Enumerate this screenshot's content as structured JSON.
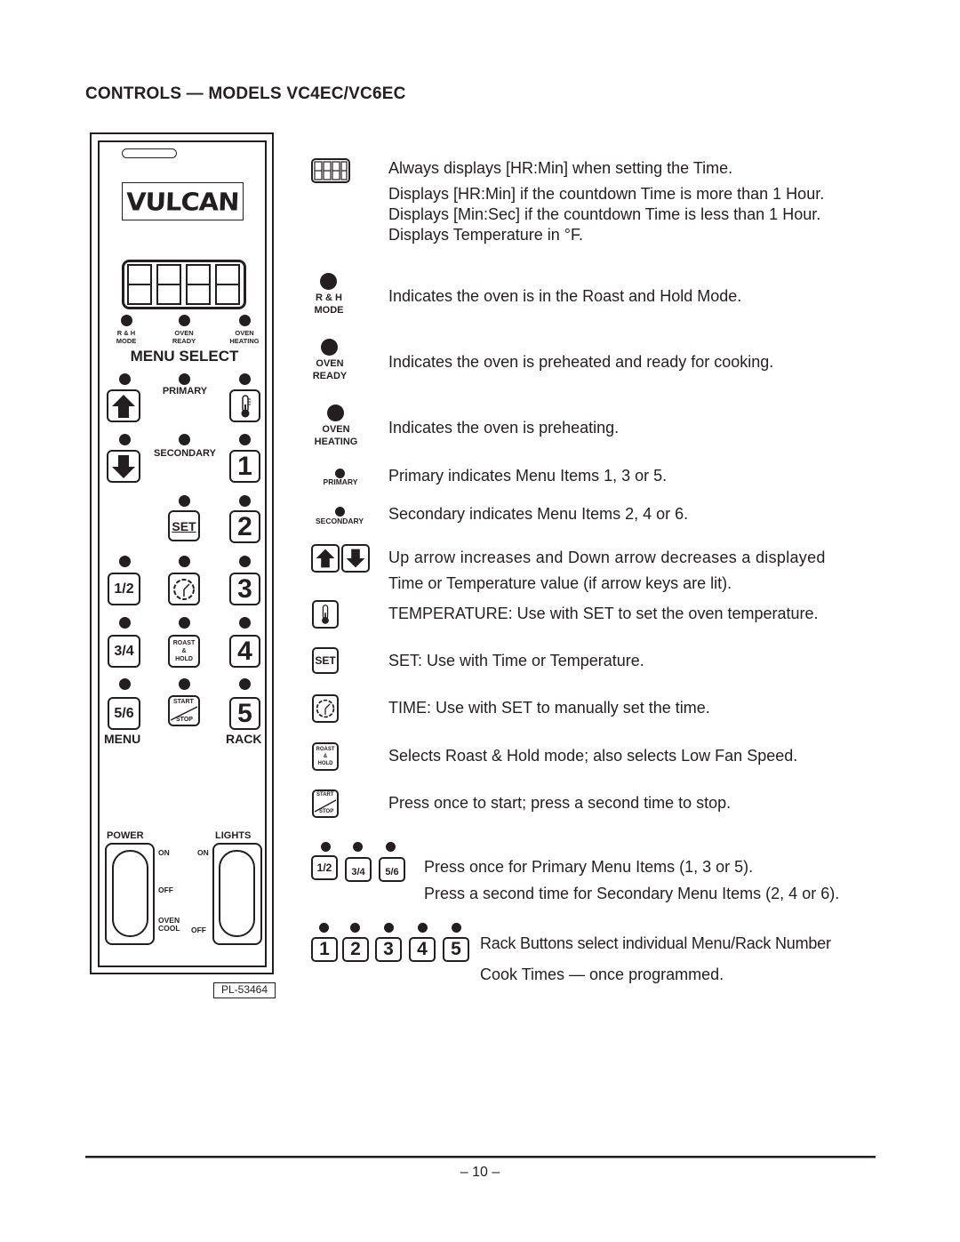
{
  "title": "CONTROLS — MODELS VC4EC/VC6EC",
  "panel": {
    "logo": "VULCAN",
    "indicators": [
      {
        "line1": "R & H",
        "line2": "MODE"
      },
      {
        "line1": "OVEN",
        "line2": "READY"
      },
      {
        "line1": "OVEN",
        "line2": "HEATING"
      }
    ],
    "menu_select": "MENU SELECT",
    "primary": "PRIMARY",
    "secondary": "SECONDARY",
    "keys": {
      "set": "SET",
      "menu_1_2": "1/2",
      "menu_3_4": "3/4",
      "menu_5_6": "5/6",
      "rack_1": "1",
      "rack_2": "2",
      "rack_3": "3",
      "rack_4": "4",
      "rack_5": "5",
      "roast_1": "ROAST",
      "roast_2": "&",
      "roast_3": "HOLD",
      "start": "START",
      "stop": "STOP"
    },
    "menu_label": "MENU",
    "rack_label": "RACK",
    "power": {
      "label": "POWER",
      "on": "ON",
      "off": "OFF",
      "oven": "OVEN",
      "cool": "COOL"
    },
    "lights": {
      "label": "LIGHTS",
      "on": "ON",
      "off": "OFF"
    },
    "part_number": "PL-53464"
  },
  "legend": {
    "display": [
      "Always displays [HR:Min] when setting the Time.",
      "Displays [HR:Min]  if the countdown Time is more than 1 Hour.",
      "Displays [Min:Sec] if the countdown Time is less than 1 Hour.",
      "Displays Temperature in °F."
    ],
    "rh_mode": {
      "label1": "R & H",
      "label2": "MODE",
      "text": "Indicates the oven is in the Roast and Hold Mode."
    },
    "oven_ready": {
      "label1": "OVEN",
      "label2": "READY",
      "text": "Indicates the oven is preheated and ready for cooking."
    },
    "oven_heating": {
      "label1": "OVEN",
      "label2": "HEATING",
      "text": "Indicates the oven is preheating."
    },
    "primary": {
      "label": "PRIMARY",
      "text": "Primary indicates Menu Items 1, 3 or 5."
    },
    "secondary": {
      "label": "SECONDARY",
      "text": "Secondary indicates Menu Items 2, 4 or 6."
    },
    "arrows": [
      "Up arrow increases and Down arrow decreases a displayed",
      "Time or Temperature value (if arrow keys are lit)."
    ],
    "temperature": "TEMPERATURE: Use with SET to set the oven temperature.",
    "set": {
      "key": "SET",
      "text": "SET: Use with Time or Temperature."
    },
    "time": "TIME: Use with SET to manually set the time.",
    "roast_hold": "Selects Roast & Hold mode; also selects Low Fan Speed.",
    "start_stop": "Press once to start; press a second time to stop.",
    "menu_keys": {
      "keys": [
        "1/2",
        "3/4",
        "5/6"
      ],
      "lines": [
        "Press once for Primary Menu Items (1, 3 or 5).",
        "Press a second time for Secondary Menu Items (2, 4 or 6)."
      ]
    },
    "rack_keys": {
      "keys": [
        "1",
        "2",
        "3",
        "4",
        "5"
      ],
      "lines": [
        "Rack Buttons select individual Menu/Rack Number",
        "Cook Times — once programmed."
      ]
    }
  },
  "footer": {
    "page": "– 10 –"
  }
}
